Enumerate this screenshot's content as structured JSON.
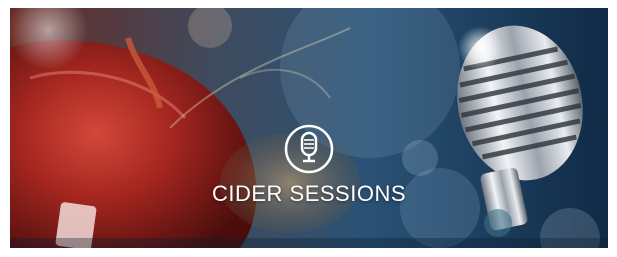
{
  "banner": {
    "title": "CIDER SESSIONS",
    "logo_icon": "microphone-icon",
    "subject_left": "red-apple",
    "subject_right": "vintage-microphone",
    "colors": {
      "apple_red": "#a3261f",
      "background_blue": "#1e3a5a",
      "text": "#ffffff"
    }
  }
}
